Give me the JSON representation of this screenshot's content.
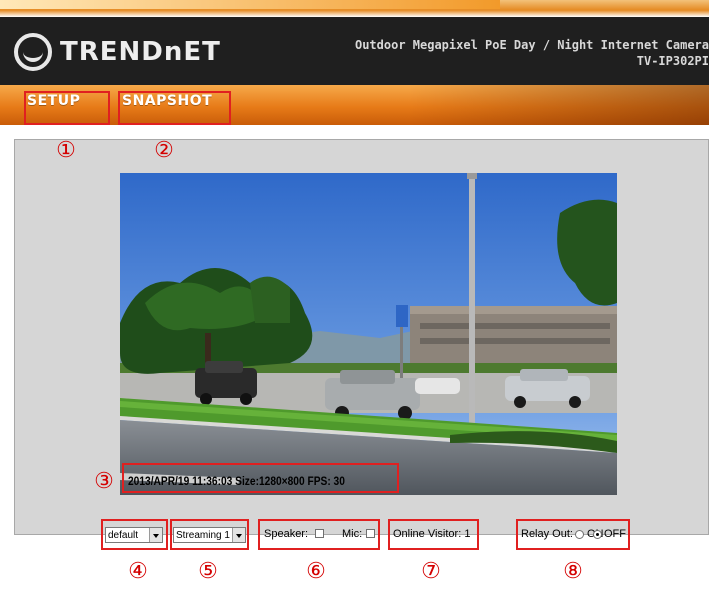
{
  "header": {
    "brand": "TRENDnET",
    "product_line1": "Outdoor Megapixel PoE Day / Night Internet Camera",
    "product_line2": "TV-IP302PI"
  },
  "nav": {
    "setup_label": "SETUP",
    "snapshot_label": "SNAPSHOT"
  },
  "video": {
    "overlay": "2013/APR/19 11:36:03 Size:1280×800 FPS: 30"
  },
  "controls": {
    "profile_select_value": "default",
    "stream_select_value": "Streaming 1",
    "speaker_label": "Speaker:",
    "speaker_checked": false,
    "mic_label": "Mic:",
    "mic_checked": false,
    "online_visitor_label": "Online Visitor: 1",
    "relay_label": "Relay Out:",
    "relay_on_label": "ON",
    "relay_off_label": "OFF",
    "relay_selected": "OFF"
  },
  "callouts": {
    "c1": "①",
    "c2": "②",
    "c3": "③",
    "c4": "④",
    "c5": "⑤",
    "c6": "⑥",
    "c7": "⑦",
    "c8": "⑧"
  },
  "colors": {
    "header_bg": "#1f1f1f",
    "nav_orange": "#e77b18",
    "callout_red": "#e02020",
    "panel_gray": "#d6d6d6"
  },
  "icons": {
    "logo": "trendnet-logo-icon",
    "dropdown": "chevron-down-icon"
  }
}
